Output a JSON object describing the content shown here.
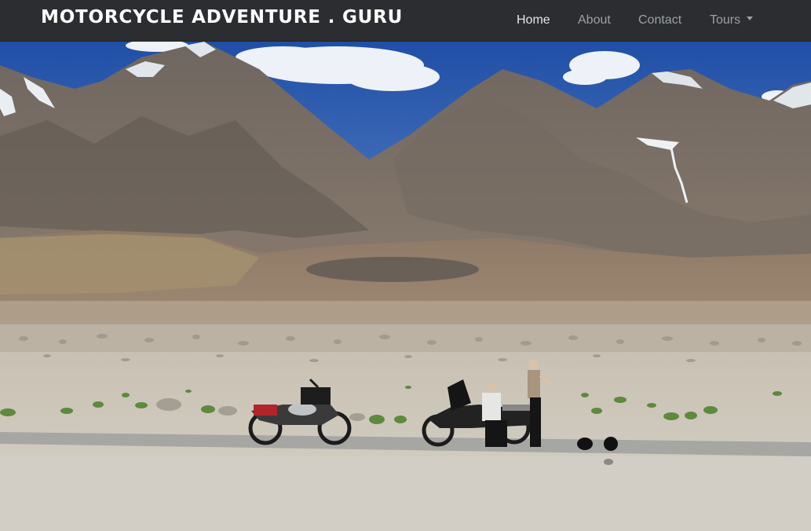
{
  "navbar": {
    "brand": "MOTORCYCLE ADVENTURE . GURU",
    "items": [
      {
        "label": "Home",
        "active": true
      },
      {
        "label": "About",
        "active": false
      },
      {
        "label": "Contact",
        "active": false
      },
      {
        "label": "Tours",
        "active": false,
        "dropdown": true
      }
    ]
  },
  "hero": {
    "image": "mountain-desert-motorcycles-photo"
  }
}
